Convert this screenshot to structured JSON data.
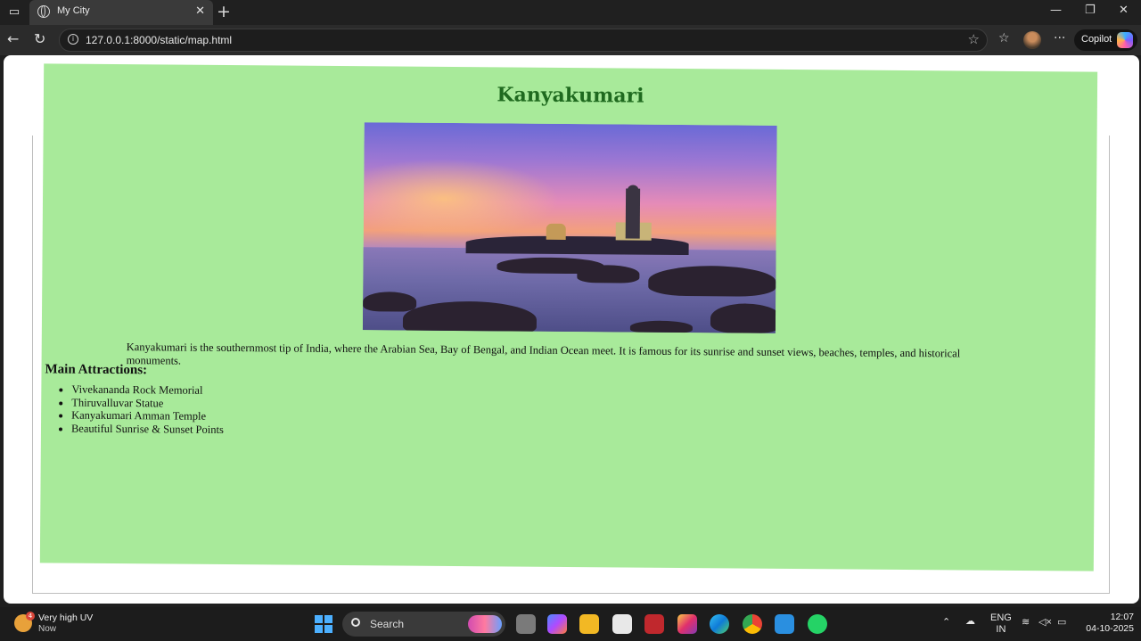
{
  "browser": {
    "tab_title": "My City",
    "url": "127.0.0.1:8000/static/map.html",
    "copilot_label": "Copilot"
  },
  "page": {
    "heading": "Kanyakumari",
    "description": "Kanyakumari is the southernmost tip of India, where the Arabian Sea, Bay of Bengal, and Indian Ocean meet. It is famous for its sunrise and sunset views, beaches, temples, and historical monuments.",
    "attractions_title": "Main Attractions:",
    "attractions": [
      "Vivekananda Rock Memorial",
      "Thiruvalluvar Statue",
      "Kanyakumari Amman Temple",
      "Beautiful Sunrise & Sunset Points"
    ],
    "background_color": "#a8ea9a",
    "heading_color": "#1f6a1f"
  },
  "taskbar": {
    "weather_title": "Very high UV",
    "weather_sub": "Now",
    "weather_badge": "4",
    "search_label": "Search",
    "lang_top": "ENG",
    "lang_bottom": "IN",
    "time": "12:07",
    "date": "04-10-2025"
  }
}
